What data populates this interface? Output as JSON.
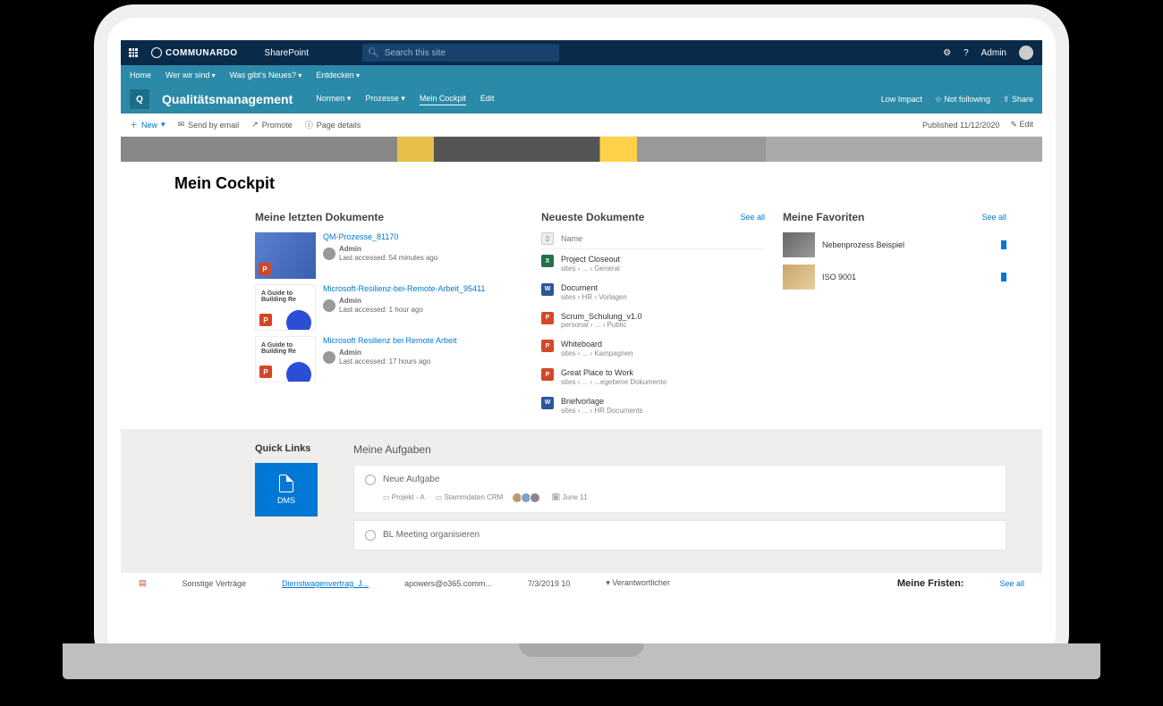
{
  "suite": {
    "brand": "COMMUNARDO",
    "app_label": "SharePoint",
    "search_placeholder": "Search this site",
    "admin_label": "Admin"
  },
  "hubnav": {
    "items": [
      "Home",
      "Wer wir sind",
      "Was gibt's Neues?",
      "Entdecken"
    ]
  },
  "site": {
    "logo_glyph": "Q",
    "title": "Qualitätsmanagement",
    "nav": [
      {
        "label": "Normen",
        "chev": true
      },
      {
        "label": "Prozesse",
        "chev": true
      },
      {
        "label": "Mein Cockpit",
        "active": true
      },
      {
        "label": "Edit"
      }
    ],
    "status_low_impact": "Low Impact",
    "status_follow": "Not following",
    "status_share": "Share"
  },
  "cmd": {
    "new": "New",
    "send": "Send by email",
    "promote": "Promote",
    "pagedetails": "Page details",
    "published_label": "Published",
    "published_date": "11/12/2020",
    "edit": "Edit"
  },
  "page": {
    "title": "Mein Cockpit"
  },
  "recent": {
    "title": "Meine letzten Dokumente",
    "items": [
      {
        "title": "QM-Prozesse_81170",
        "author": "Admin",
        "when": "Last accessed: 54 minutes ago",
        "kind": "blue"
      },
      {
        "title": "Microsoft-Resilienz-bei-Remote-Arbeit_95411",
        "author": "Admin",
        "when": "Last accessed: 1 hour ago",
        "kind": "white"
      },
      {
        "title": "Microsoft Resilienz bei Remote Arbeit",
        "author": "Admin",
        "when": "Last accessed: 17 hours ago",
        "kind": "white"
      }
    ]
  },
  "newest": {
    "title": "Neueste Dokumente",
    "seeall": "See all",
    "name_col": "Name",
    "rows": [
      {
        "icon": "x",
        "name": "Project Closeout",
        "path": "sites › ... › General"
      },
      {
        "icon": "w",
        "name": "Document",
        "path": "sites › HR › Vorlagen"
      },
      {
        "icon": "p",
        "name": "Scrum_Schulung_v1.0",
        "path": "personal › ... › Public"
      },
      {
        "icon": "p",
        "name": "Whiteboard",
        "path": "sites › ... › Kampagnen"
      },
      {
        "icon": "p",
        "name": "Great Place to Work",
        "path": "sites › ... › ...egebene Dokumente"
      },
      {
        "icon": "w",
        "name": "Briefvorlage",
        "path": "sites › ... › HR Documents"
      }
    ]
  },
  "favorites": {
    "title": "Meine Favoriten",
    "seeall": "See all",
    "rows": [
      {
        "name": "Nebenprozess Beispiel"
      },
      {
        "name": "ISO 9001"
      }
    ]
  },
  "quicklinks": {
    "title": "Quick Links",
    "tile": "DMS"
  },
  "tasks": {
    "title": "Meine Aufgaben",
    "items": [
      {
        "name": "Neue Aufgabe",
        "tags": [
          "Projekt - A",
          "Stammdaten CRM"
        ],
        "due": "June 11"
      },
      {
        "name": "BL Meeting organisieren"
      }
    ]
  },
  "bottom": {
    "cat": "Sonstige Verträge",
    "doc": "Dienstwagenvertrag_J...",
    "email": "apowers@o365.comm...",
    "date": "7/3/2019 10",
    "resp": "Verantwortlicher",
    "fristen": "Meine Fristen:",
    "seeall": "See all"
  }
}
